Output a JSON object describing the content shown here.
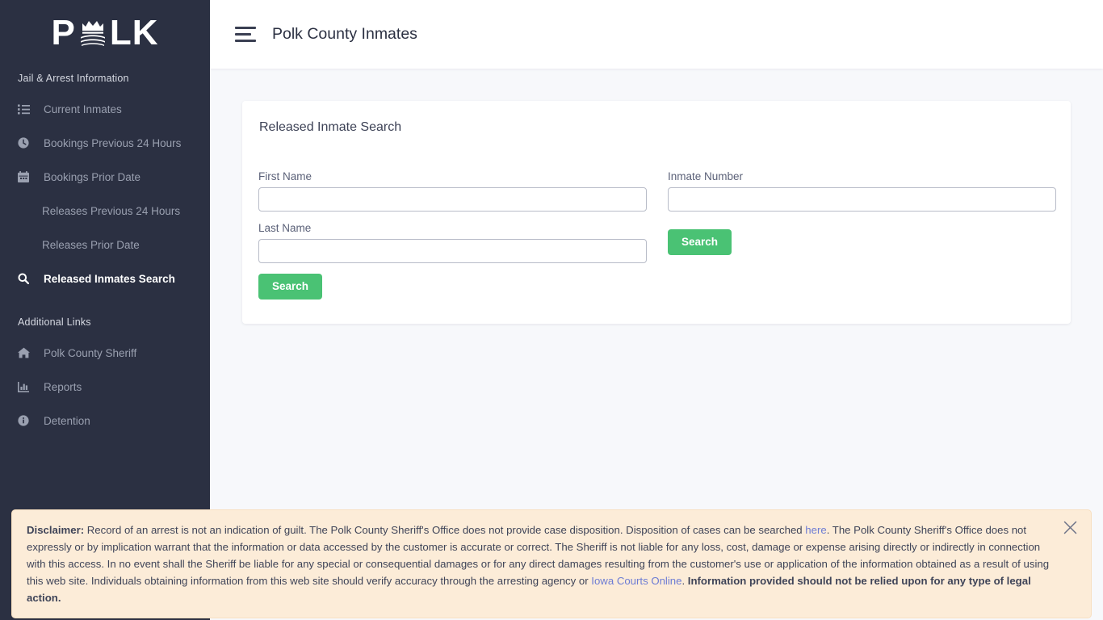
{
  "brand": {
    "text_before": "P",
    "mark_icon": "polk-crown-field-icon",
    "text_after": "LK"
  },
  "sidebar": {
    "section_primary_heading": "Jail & Arrest Information",
    "section_secondary_heading": "Additional Links",
    "primary_items": [
      {
        "label": "Current Inmates",
        "icon": "list-ul-icon",
        "active": false,
        "has_icon": true
      },
      {
        "label": "Bookings Previous 24 Hours",
        "icon": "clock-icon",
        "active": false,
        "has_icon": true
      },
      {
        "label": "Bookings Prior Date",
        "icon": "calendar-icon",
        "active": false,
        "has_icon": true
      },
      {
        "label": "Releases Previous 24 Hours",
        "icon": "",
        "active": false,
        "has_icon": false
      },
      {
        "label": "Releases Prior Date",
        "icon": "",
        "active": false,
        "has_icon": false
      },
      {
        "label": "Released Inmates Search",
        "icon": "search-icon",
        "active": true,
        "has_icon": true
      }
    ],
    "secondary_items": [
      {
        "label": "Polk County Sheriff",
        "icon": "home-icon",
        "active": false,
        "has_icon": true
      },
      {
        "label": "Reports",
        "icon": "bar-chart-icon",
        "active": false,
        "has_icon": true
      },
      {
        "label": "Detention",
        "icon": "info-circle-icon",
        "active": false,
        "has_icon": true
      }
    ]
  },
  "header": {
    "menu_icon": "hamburger-icon",
    "title": "Polk County Inmates"
  },
  "search_card": {
    "title": "Released Inmate Search",
    "first_name_label": "First Name",
    "first_name_value": "",
    "last_name_label": "Last Name",
    "last_name_value": "",
    "inmate_number_label": "Inmate Number",
    "inmate_number_value": "",
    "search_button_left": "Search",
    "search_button_right": "Search"
  },
  "disclaimer": {
    "label": "Disclaimer:",
    "part1": " Record of an arrest is not an indication of guilt. The Polk County Sheriff's Office does not provide case disposition. Disposition of cases can be searched ",
    "link_here": "here",
    "part2": ". The Polk County Sheriff's Office does not expressly or by implication warrant that the information or data accessed by the customer is accurate or correct. The Sheriff is not liable for any loss, cost, damage or expense arising directly or indirectly in connection with this access. In no event shall the Sheriff be liable for any special or consequential damages or for any direct damages resulting from the customer's use or application of the information obtained as a result of using this web site. Individuals obtaining information from this web site should verify accuracy through the arresting agency or ",
    "link_iowa": "Iowa Courts Online",
    "part3": ". ",
    "bold_tail": "Information provided should not be relied upon for any type of legal action.",
    "close_icon": "close-icon"
  },
  "colors": {
    "sidebar_bg": "#2b3042",
    "content_bg": "#f7f8fb",
    "accent_green": "#4ac274",
    "banner_bg": "#fcecd8",
    "link_blue": "#6d7cd4"
  }
}
